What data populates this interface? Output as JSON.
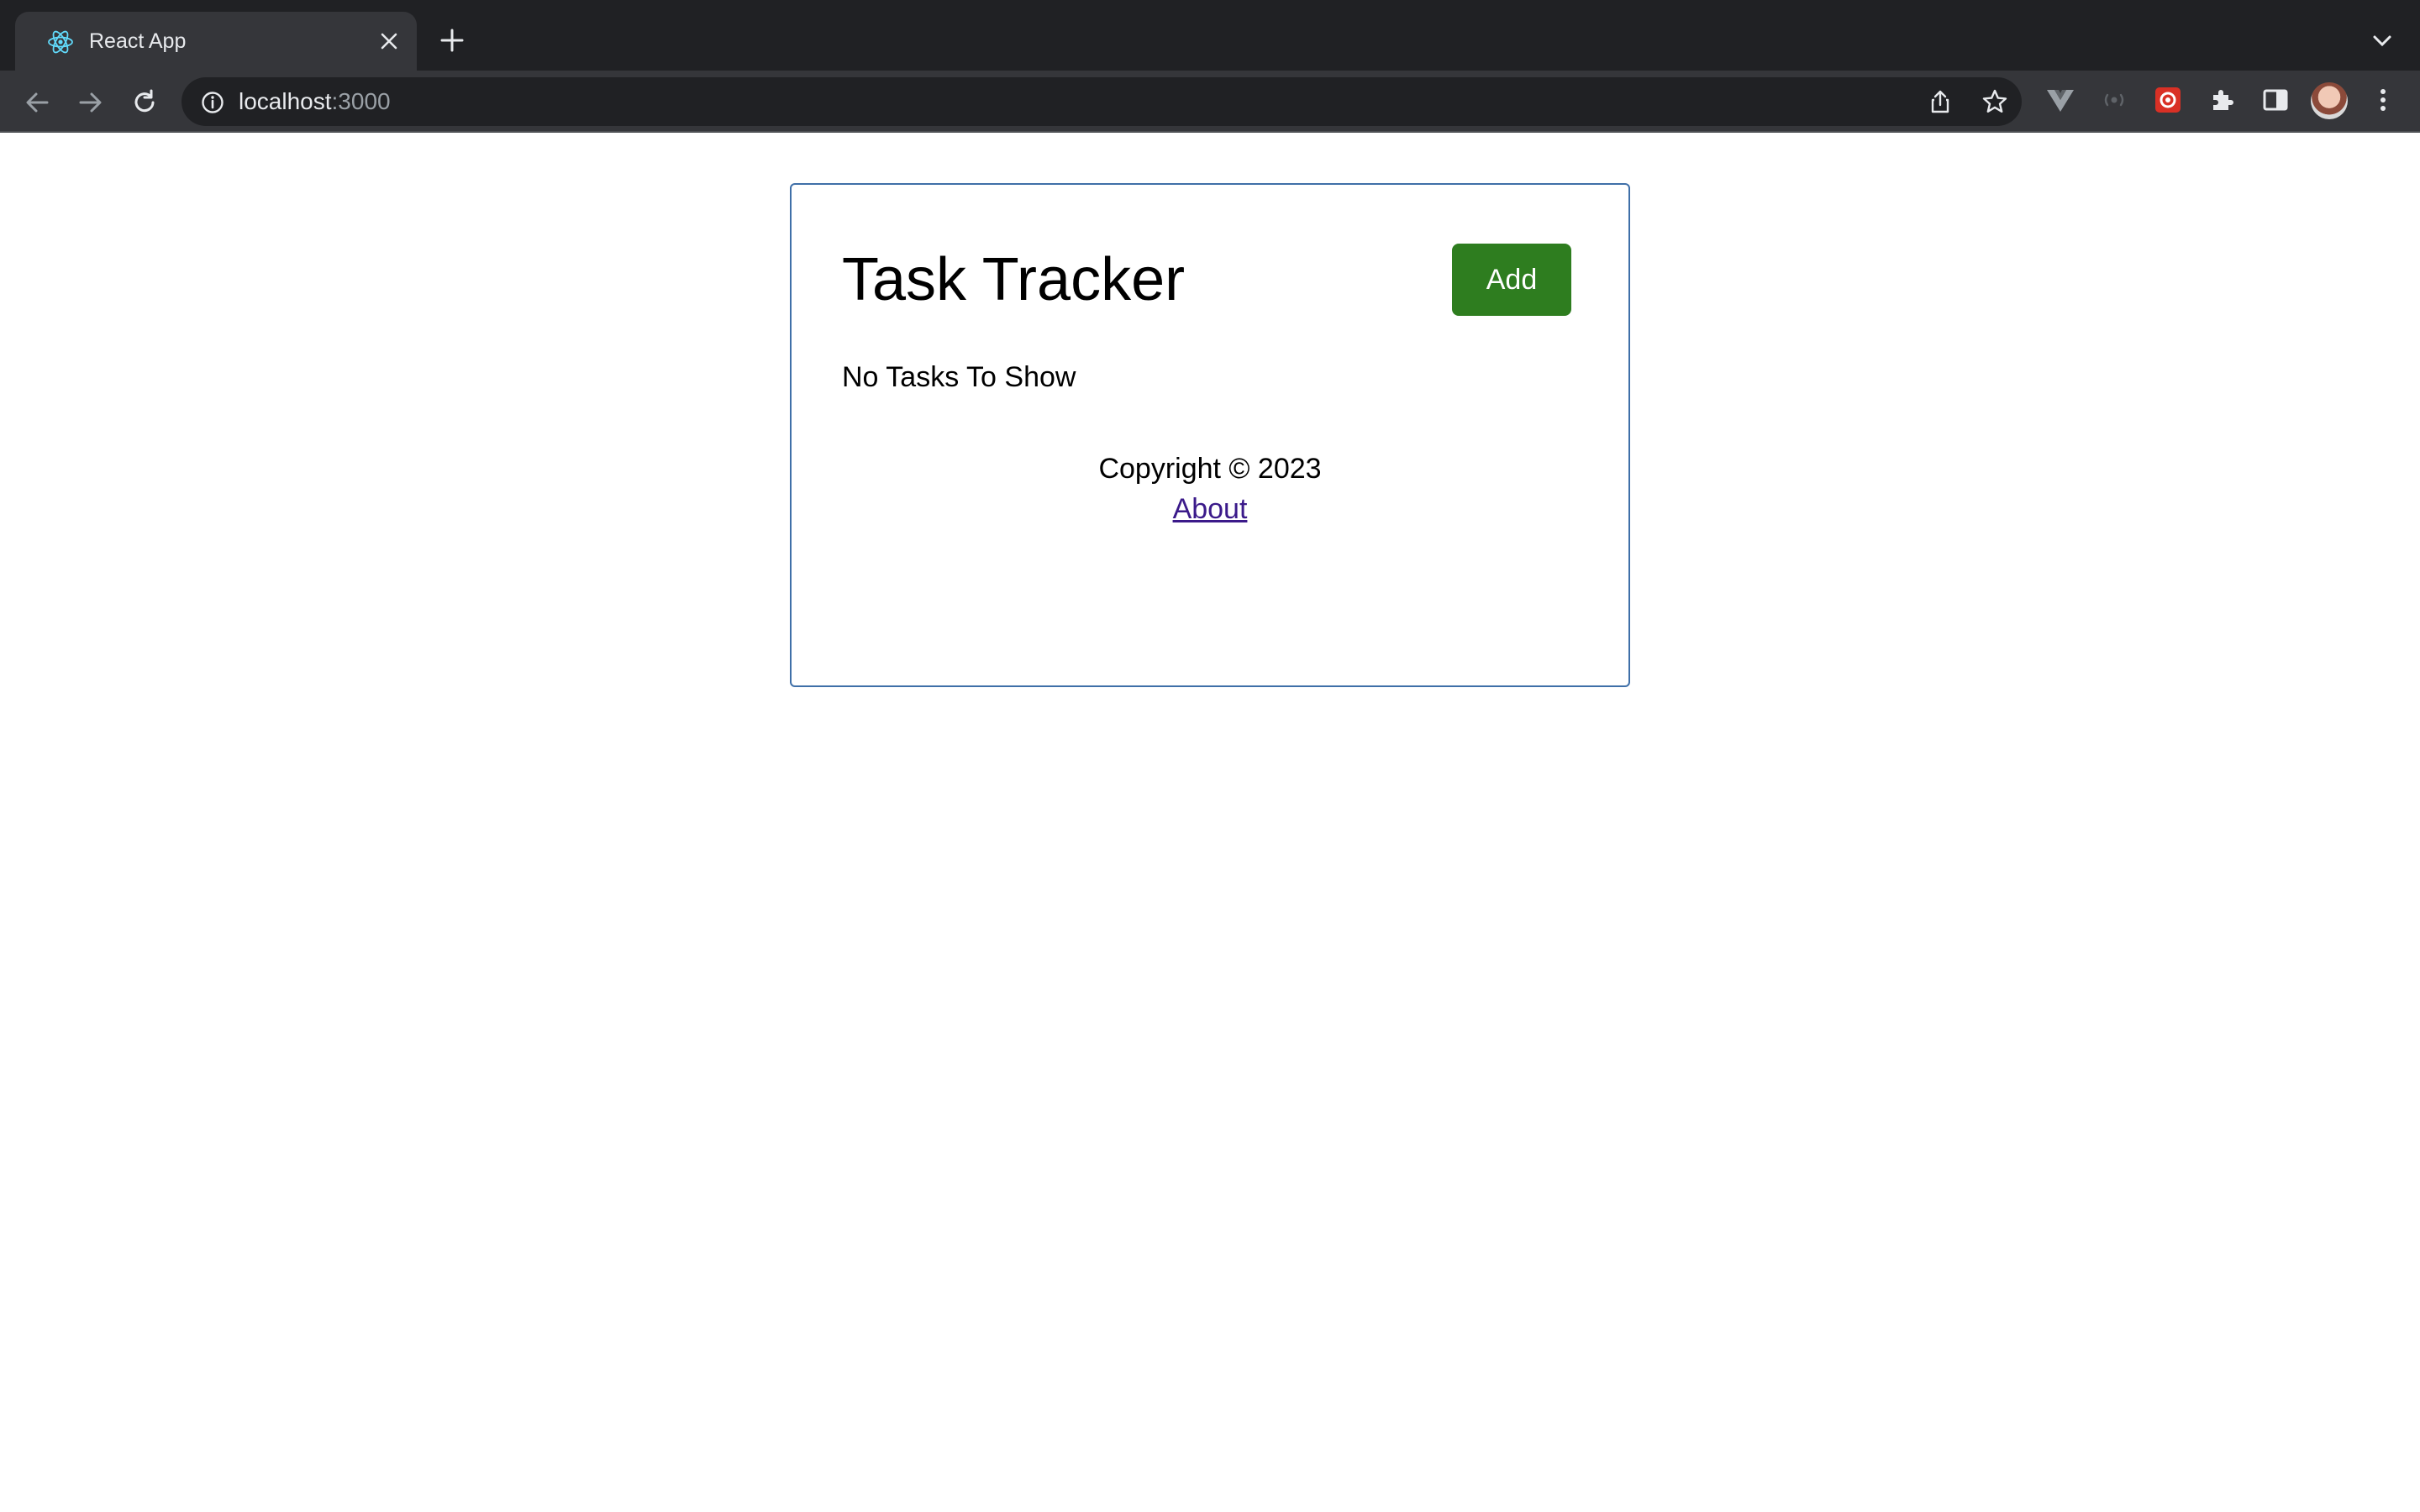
{
  "browser": {
    "tab_title": "React App",
    "url_host": "localhost",
    "url_port": ":3000",
    "colors": {
      "frame": "#202124",
      "toolbar": "#35363a",
      "text": "#e8eaed"
    },
    "icons": [
      "react-favicon-icon",
      "close-icon",
      "plus-icon",
      "chevron-down-icon",
      "back-arrow-icon",
      "forward-arrow-icon",
      "reload-icon",
      "info-icon",
      "share-icon",
      "star-icon",
      "vue-extension-icon",
      "radio-extension-icon",
      "red-extension-icon",
      "puzzle-extension-icon",
      "side-panel-icon",
      "avatar",
      "more-vert-icon"
    ]
  },
  "app": {
    "title": "Task Tracker",
    "add_label": "Add",
    "empty_message": "No Tasks To Show",
    "footer_copyright": "Copyright © 2023",
    "footer_link": "About",
    "colors": {
      "accent": "#2e7d1f",
      "border": "#3f6fa8",
      "link": "#3b1a8a"
    }
  }
}
